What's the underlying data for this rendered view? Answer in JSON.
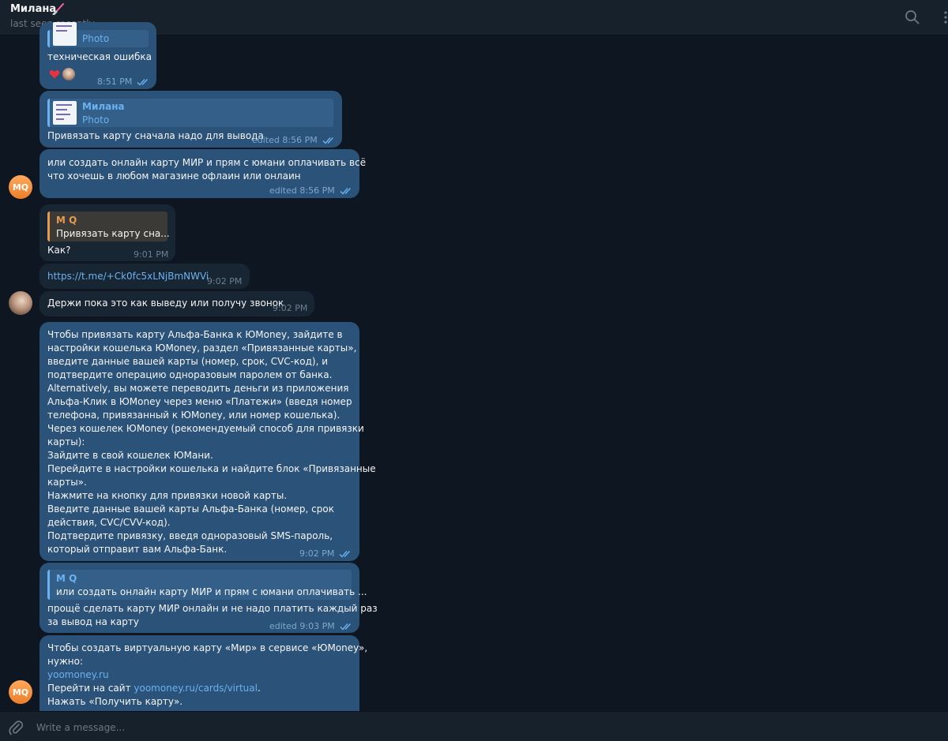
{
  "header": {
    "name": "Милана",
    "status": "last seen recently"
  },
  "messages": [
    {
      "id": "m1",
      "quote_sub": "Photo",
      "text": "техническая ошибка",
      "time": "8:51 PM"
    },
    {
      "id": "m2",
      "quote_name": "Милана",
      "quote_sub": "Photo",
      "text": "Привязать карту сначала надо для вывода",
      "time": "edited 8:56 PM"
    },
    {
      "id": "m3",
      "avatar_initials": "MQ",
      "lines": [
        "или создать онлайн карту МИР и прям с юмани оплачивать всё",
        "что хочешь в любом магазине офлаин или онлаин"
      ],
      "time": "edited 8:56 PM"
    },
    {
      "id": "m4",
      "quote_name": "M Q",
      "quote_text": "Привязать карту сна...",
      "text": "Как?",
      "time": "9:01 PM"
    },
    {
      "id": "m5",
      "text": "https://t.me/+Ck0fc5xLNjBmNWVi",
      "time": "9:02 PM"
    },
    {
      "id": "m6",
      "text": "Держи пока это как выведу или получу звонок",
      "time": "9:02 PM"
    },
    {
      "id": "m7",
      "lines": [
        "Чтобы привязать карту Альфа-Банка к ЮMoney, зайдите в",
        "настройки кошелька ЮMoney, раздел «Привязанные карты»,",
        "введите данные вашей карты (номер, срок, CVC-код), и",
        "подтвердите операцию одноразовым паролем от банка.",
        "Alternatively, вы можете переводить деньги из приложения",
        "Альфа-Клик в ЮMoney через меню «Платежи» (введя номер",
        "телефона, привязанный к ЮMoney, или номер кошелька).",
        "Через кошелек ЮMoney (рекомендуемый способ для привязки",
        "карты):",
        "Зайдите в свой кошелек ЮМани.",
        "Перейдите в настройки кошелька и найдите блок «Привязанные",
        "карты».",
        "Нажмите на кнопку для привязки новой карты.",
        "Введите данные вашей карты Альфа-Банка (номер, срок",
        "действия, CVC/CVV-код).",
        "Подтвердите привязку, введя одноразовый SMS-пароль,",
        "который отправит вам Альфа-Банк."
      ],
      "time": "9:02 PM"
    },
    {
      "id": "m8",
      "quote_name": "M Q",
      "quote_text": "или создать онлайн карту МИР и прям с юмани оплачивать ...",
      "lines": [
        "прощё сделать карту МИР онлайн и не надо платить каждый раз",
        "за вывод на карту"
      ],
      "time": "edited 9:03 PM"
    },
    {
      "id": "m9",
      "avatar_initials": "MQ",
      "lines": [
        "Чтобы создать виртуальную карту «Мир» в сервисе «ЮMoney»,",
        "нужно:"
      ],
      "link1": "yoomoney.ru",
      "line3_prefix": "Перейти на сайт ",
      "link2": "yoomoney.ru/cards/virtual",
      "line3_suffix": ".",
      "line4": "Нажать «Получить карту»."
    }
  ],
  "composer": {
    "placeholder": "Write a message..."
  },
  "colors": {
    "background": "#0e1621",
    "header": "#17212b",
    "outgoing_bubble": "#2b5278",
    "incoming_bubble": "#182533",
    "link": "#6ab2f2",
    "avatar_orange": "#f28c38"
  },
  "icons": [
    "lightsaber-emoji-icon",
    "search-icon",
    "more-vertical-icon",
    "double-check-icon",
    "heart-icon",
    "attach-paperclip-icon"
  ]
}
